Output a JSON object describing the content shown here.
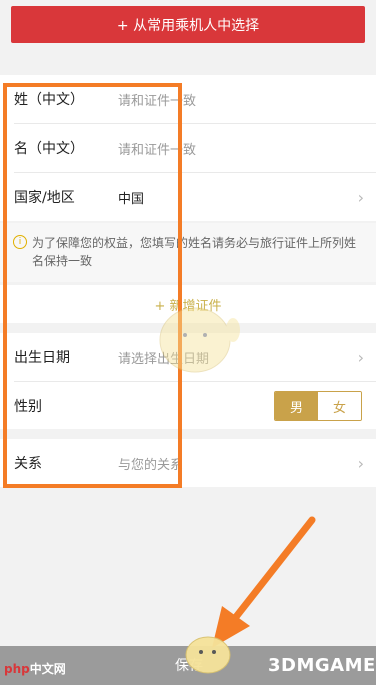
{
  "top_button": {
    "label": "+ 从常用乘机人中选择"
  },
  "name_section": {
    "surname": {
      "label": "姓（中文）",
      "placeholder": "请和证件一致"
    },
    "given_name": {
      "label": "名（中文）",
      "placeholder": "请和证件一致"
    },
    "country": {
      "label": "国家/地区",
      "value": "中国"
    }
  },
  "notice": {
    "text": "为了保障您的权益，您填写的姓名请务必与旅行证件上所列姓名保持一致"
  },
  "add_certificate": {
    "label": "+ 新增证件"
  },
  "birth": {
    "label": "出生日期",
    "placeholder": "请选择出生日期"
  },
  "gender": {
    "label": "性别",
    "male": "男",
    "female": "女",
    "selected": "男"
  },
  "relation": {
    "label": "关系",
    "placeholder": "与您的关系"
  },
  "bottom": {
    "save_label": "保存"
  },
  "watermarks": {
    "left_php": "php",
    "left_site": "中文网",
    "right": "3DMGAME"
  },
  "colors": {
    "accent_red": "#d9373a",
    "gold": "#c9a24a",
    "annotation_orange": "#f47c26"
  }
}
